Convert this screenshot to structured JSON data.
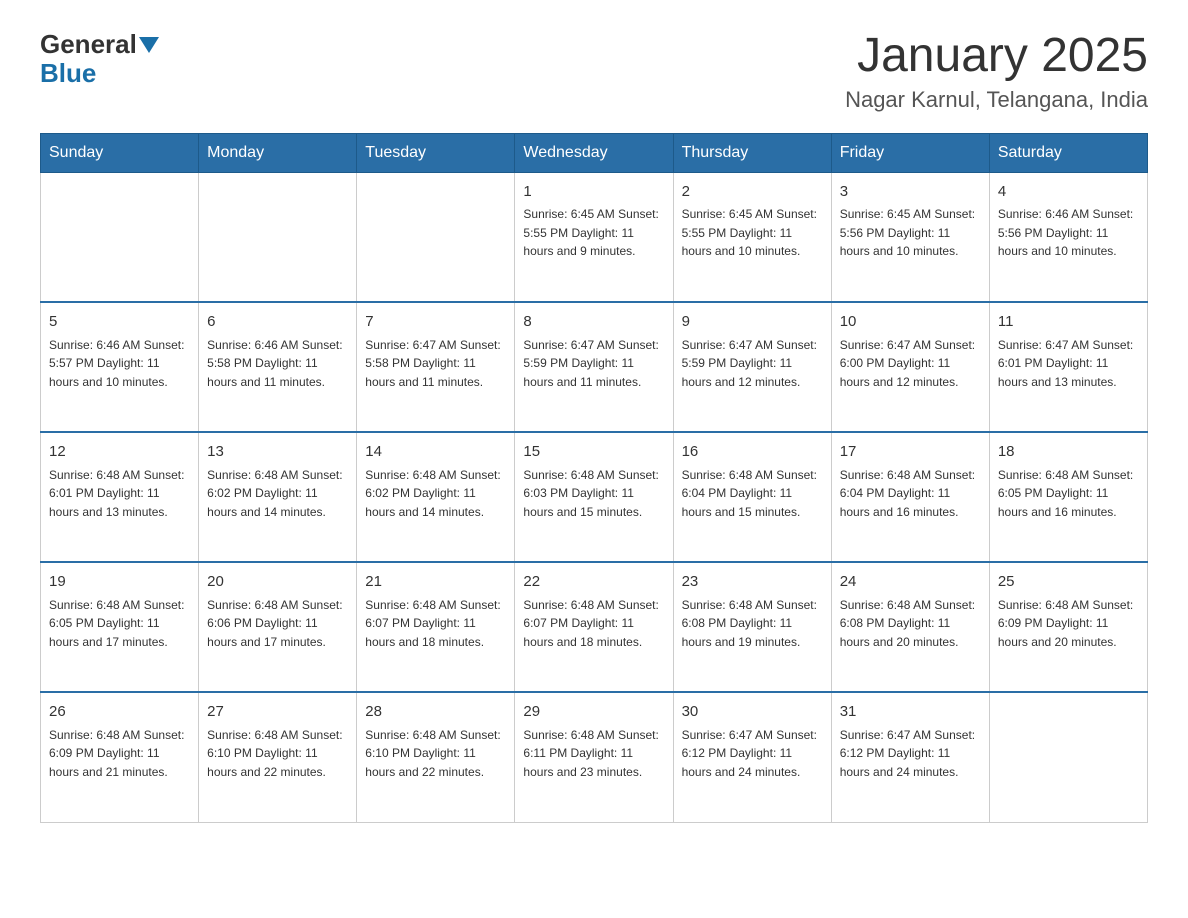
{
  "header": {
    "logo_general": "General",
    "logo_blue": "Blue",
    "title": "January 2025",
    "subtitle": "Nagar Karnul, Telangana, India"
  },
  "days_of_week": [
    "Sunday",
    "Monday",
    "Tuesday",
    "Wednesday",
    "Thursday",
    "Friday",
    "Saturday"
  ],
  "weeks": [
    [
      {
        "day": "",
        "info": ""
      },
      {
        "day": "",
        "info": ""
      },
      {
        "day": "",
        "info": ""
      },
      {
        "day": "1",
        "info": "Sunrise: 6:45 AM\nSunset: 5:55 PM\nDaylight: 11 hours and 9 minutes."
      },
      {
        "day": "2",
        "info": "Sunrise: 6:45 AM\nSunset: 5:55 PM\nDaylight: 11 hours and 10 minutes."
      },
      {
        "day": "3",
        "info": "Sunrise: 6:45 AM\nSunset: 5:56 PM\nDaylight: 11 hours and 10 minutes."
      },
      {
        "day": "4",
        "info": "Sunrise: 6:46 AM\nSunset: 5:56 PM\nDaylight: 11 hours and 10 minutes."
      }
    ],
    [
      {
        "day": "5",
        "info": "Sunrise: 6:46 AM\nSunset: 5:57 PM\nDaylight: 11 hours and 10 minutes."
      },
      {
        "day": "6",
        "info": "Sunrise: 6:46 AM\nSunset: 5:58 PM\nDaylight: 11 hours and 11 minutes."
      },
      {
        "day": "7",
        "info": "Sunrise: 6:47 AM\nSunset: 5:58 PM\nDaylight: 11 hours and 11 minutes."
      },
      {
        "day": "8",
        "info": "Sunrise: 6:47 AM\nSunset: 5:59 PM\nDaylight: 11 hours and 11 minutes."
      },
      {
        "day": "9",
        "info": "Sunrise: 6:47 AM\nSunset: 5:59 PM\nDaylight: 11 hours and 12 minutes."
      },
      {
        "day": "10",
        "info": "Sunrise: 6:47 AM\nSunset: 6:00 PM\nDaylight: 11 hours and 12 minutes."
      },
      {
        "day": "11",
        "info": "Sunrise: 6:47 AM\nSunset: 6:01 PM\nDaylight: 11 hours and 13 minutes."
      }
    ],
    [
      {
        "day": "12",
        "info": "Sunrise: 6:48 AM\nSunset: 6:01 PM\nDaylight: 11 hours and 13 minutes."
      },
      {
        "day": "13",
        "info": "Sunrise: 6:48 AM\nSunset: 6:02 PM\nDaylight: 11 hours and 14 minutes."
      },
      {
        "day": "14",
        "info": "Sunrise: 6:48 AM\nSunset: 6:02 PM\nDaylight: 11 hours and 14 minutes."
      },
      {
        "day": "15",
        "info": "Sunrise: 6:48 AM\nSunset: 6:03 PM\nDaylight: 11 hours and 15 minutes."
      },
      {
        "day": "16",
        "info": "Sunrise: 6:48 AM\nSunset: 6:04 PM\nDaylight: 11 hours and 15 minutes."
      },
      {
        "day": "17",
        "info": "Sunrise: 6:48 AM\nSunset: 6:04 PM\nDaylight: 11 hours and 16 minutes."
      },
      {
        "day": "18",
        "info": "Sunrise: 6:48 AM\nSunset: 6:05 PM\nDaylight: 11 hours and 16 minutes."
      }
    ],
    [
      {
        "day": "19",
        "info": "Sunrise: 6:48 AM\nSunset: 6:05 PM\nDaylight: 11 hours and 17 minutes."
      },
      {
        "day": "20",
        "info": "Sunrise: 6:48 AM\nSunset: 6:06 PM\nDaylight: 11 hours and 17 minutes."
      },
      {
        "day": "21",
        "info": "Sunrise: 6:48 AM\nSunset: 6:07 PM\nDaylight: 11 hours and 18 minutes."
      },
      {
        "day": "22",
        "info": "Sunrise: 6:48 AM\nSunset: 6:07 PM\nDaylight: 11 hours and 18 minutes."
      },
      {
        "day": "23",
        "info": "Sunrise: 6:48 AM\nSunset: 6:08 PM\nDaylight: 11 hours and 19 minutes."
      },
      {
        "day": "24",
        "info": "Sunrise: 6:48 AM\nSunset: 6:08 PM\nDaylight: 11 hours and 20 minutes."
      },
      {
        "day": "25",
        "info": "Sunrise: 6:48 AM\nSunset: 6:09 PM\nDaylight: 11 hours and 20 minutes."
      }
    ],
    [
      {
        "day": "26",
        "info": "Sunrise: 6:48 AM\nSunset: 6:09 PM\nDaylight: 11 hours and 21 minutes."
      },
      {
        "day": "27",
        "info": "Sunrise: 6:48 AM\nSunset: 6:10 PM\nDaylight: 11 hours and 22 minutes."
      },
      {
        "day": "28",
        "info": "Sunrise: 6:48 AM\nSunset: 6:10 PM\nDaylight: 11 hours and 22 minutes."
      },
      {
        "day": "29",
        "info": "Sunrise: 6:48 AM\nSunset: 6:11 PM\nDaylight: 11 hours and 23 minutes."
      },
      {
        "day": "30",
        "info": "Sunrise: 6:47 AM\nSunset: 6:12 PM\nDaylight: 11 hours and 24 minutes."
      },
      {
        "day": "31",
        "info": "Sunrise: 6:47 AM\nSunset: 6:12 PM\nDaylight: 11 hours and 24 minutes."
      },
      {
        "day": "",
        "info": ""
      }
    ]
  ]
}
